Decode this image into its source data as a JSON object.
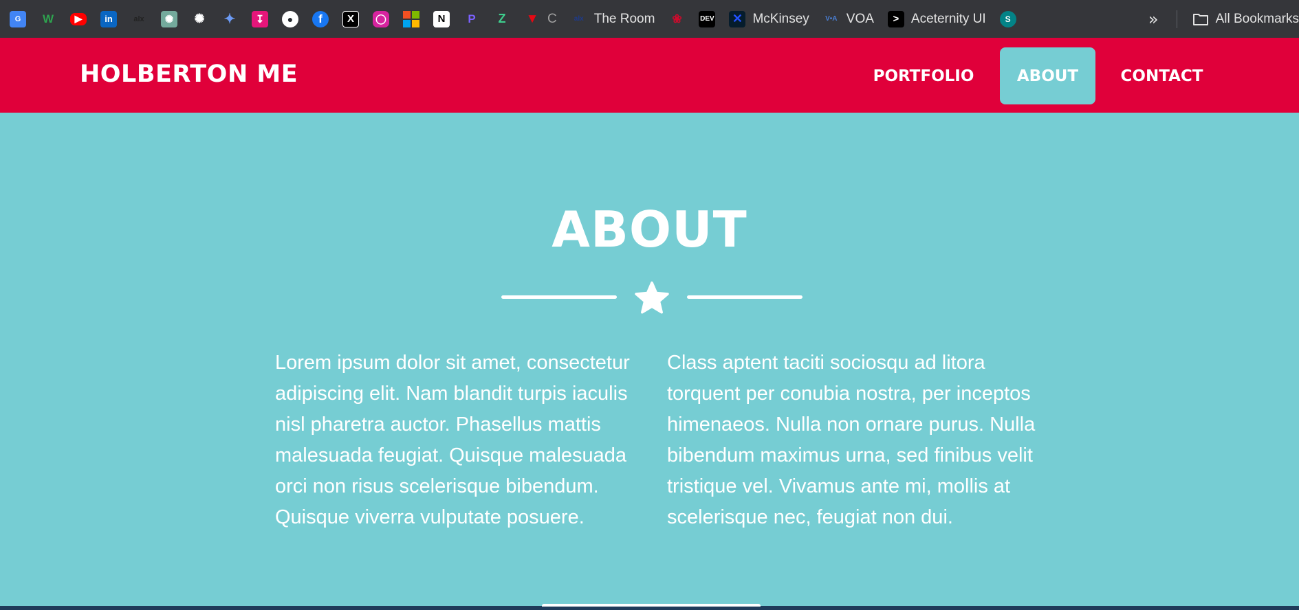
{
  "bookmarks": [
    {
      "icon": "google-translate-icon",
      "label": ""
    },
    {
      "icon": "w-icon",
      "label": ""
    },
    {
      "icon": "youtube-icon",
      "label": ""
    },
    {
      "icon": "linkedin-icon",
      "label": ""
    },
    {
      "icon": "alx-icon",
      "label": ""
    },
    {
      "icon": "chatgpt-icon",
      "label": ""
    },
    {
      "icon": "openai-icon",
      "label": ""
    },
    {
      "icon": "gemini-icon",
      "label": ""
    },
    {
      "icon": "download-icon",
      "label": ""
    },
    {
      "icon": "github-icon",
      "label": ""
    },
    {
      "icon": "facebook-icon",
      "label": ""
    },
    {
      "icon": "x-icon",
      "label": ""
    },
    {
      "icon": "instagram-icon",
      "label": ""
    },
    {
      "icon": "microsoft-icon",
      "label": ""
    },
    {
      "icon": "notion-icon",
      "label": ""
    },
    {
      "icon": "p-icon",
      "label": ""
    },
    {
      "icon": "z-icon",
      "label": ""
    },
    {
      "icon": "v-icon",
      "label": "C"
    },
    {
      "icon": "alx-room-icon",
      "label": "The Room"
    },
    {
      "icon": "huawei-icon",
      "label": ""
    },
    {
      "icon": "dev-icon",
      "label": ""
    },
    {
      "icon": "mckinsey-icon",
      "label": "McKinsey"
    },
    {
      "icon": "voa-icon",
      "label": "VOA"
    },
    {
      "icon": "aceternity-icon",
      "label": "Aceternity UI"
    },
    {
      "icon": "sharepoint-icon",
      "label": ""
    }
  ],
  "bookmarks_more": "»",
  "all_bookmarks": "All Bookmarks",
  "navbar": {
    "brand": "HOLBERTON ME",
    "links": [
      "PORTFOLIO",
      "ABOUT",
      "CONTACT"
    ],
    "active": "ABOUT"
  },
  "about": {
    "title": "ABOUT",
    "col_left": "Lorem ipsum dolor sit amet, consectetur adipiscing elit. Nam blandit turpis iaculis nisl pharetra auctor. Phasellus mattis malesuada feugiat. Quisque malesuada orci non risus scelerisque bibendum. Quisque viverra vulputate posuere.",
    "col_right": "Class aptent taciti sociosqu ad litora torquent per conubia nostra, per inceptos himenaeos. Nulla non ornare purus. Nulla bibendum maximus urna, sed finibus velit tristique vel. Vivamus ante mi, mollis at scelerisque nec, feugiat non dui."
  },
  "colors": {
    "brand_red": "#e0003a",
    "teal": "#76cdd3",
    "chrome_bar": "#35363a"
  }
}
